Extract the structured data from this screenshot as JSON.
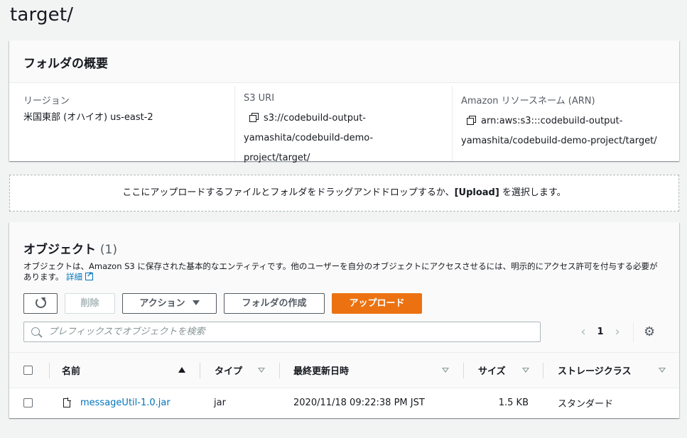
{
  "page": {
    "title": "target/"
  },
  "overview": {
    "heading": "フォルダの概要",
    "region_label": "リージョン",
    "region_value": "米国東部 (オハイオ) us-east-2",
    "s3uri_label": "S3 URI",
    "s3uri_line1": "s3://codebuild-output-",
    "s3uri_line2": "yamashita/codebuild-demo-project/target/",
    "arn_label": "Amazon リソースネーム (ARN)",
    "arn_line1": "arn:aws:s3:::codebuild-output-",
    "arn_line2": "yamashita/codebuild-demo-project/target/"
  },
  "dropzone": {
    "text_before": "ここにアップロードするファイルとフォルダをドラッグアンドドロップするか、",
    "text_bold": "[Upload]",
    "text_after": " を選択します。"
  },
  "objects": {
    "title": "オブジェクト",
    "count": "(1)",
    "description": "オブジェクトは、Amazon S3 に保存された基本的なエンティティです。他のユーザーを自分のオブジェクトにアクセスさせるには、明示的にアクセス許可を付与する必要があります。",
    "details_link": "詳細",
    "buttons": {
      "delete": "削除",
      "actions": "アクション",
      "create_folder": "フォルダの作成",
      "upload": "アップロード"
    },
    "search_placeholder": "プレフィックスでオブジェクトを検索",
    "pager": {
      "prev": "‹",
      "page": "1",
      "next": "›"
    },
    "columns": {
      "name": "名前",
      "type": "タイプ",
      "modified": "最終更新日時",
      "size": "サイズ",
      "storage": "ストレージクラス"
    },
    "rows": [
      {
        "name": "messageUtil-1.0.jar",
        "type": "jar",
        "modified": "2020/11/18 09:22:38 PM JST",
        "size": "1.5 KB",
        "storage": "スタンダード"
      }
    ]
  },
  "colors": {
    "accent": "#ec7211",
    "link": "#0073bb"
  }
}
